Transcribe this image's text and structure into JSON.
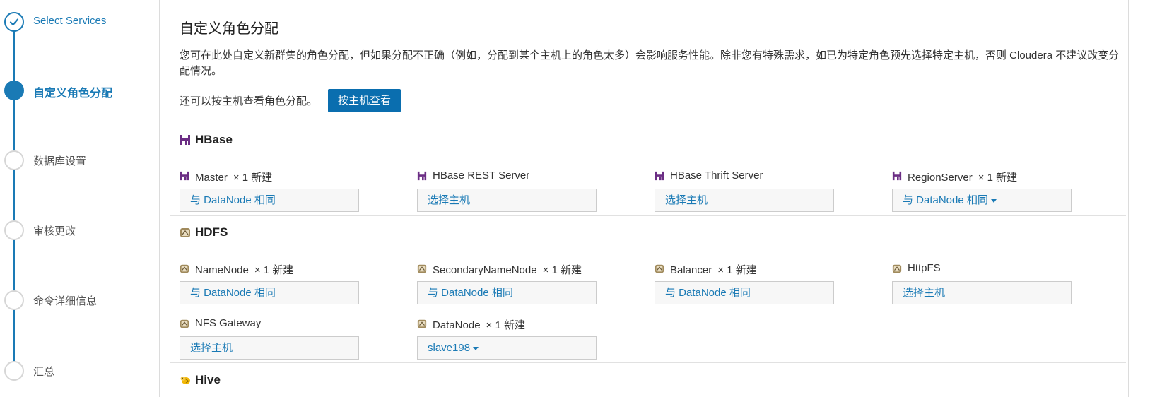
{
  "wizard": {
    "steps": [
      {
        "label": "Select Services",
        "state": "done"
      },
      {
        "label": "自定义角色分配",
        "state": "active"
      },
      {
        "label": "数据库设置",
        "state": "todo"
      },
      {
        "label": "审核更改",
        "state": "todo"
      },
      {
        "label": "命令详细信息",
        "state": "todo"
      },
      {
        "label": "汇总",
        "state": "todo"
      }
    ]
  },
  "page": {
    "title": "自定义角色分配",
    "intro": "您可在此处自定义新群集的角色分配，但如果分配不正确（例如，分配到某个主机上的角色太多）会影响服务性能。除非您有特殊需求，如已为特定角色预先选择特定主机，否则 Cloudera 不建议改变分配情况。",
    "byhost_text": "还可以按主机查看角色分配。",
    "byhost_button": "按主机查看"
  },
  "services": [
    {
      "name": "HBase",
      "icon": "hbase-icon",
      "roles": [
        {
          "name": "Master",
          "count": "× 1 新建",
          "value": "与 DataNode 相同",
          "dropdown": false
        },
        {
          "name": "HBase REST Server",
          "count": "",
          "value": "选择主机",
          "dropdown": false
        },
        {
          "name": "HBase Thrift Server",
          "count": "",
          "value": "选择主机",
          "dropdown": false
        },
        {
          "name": "RegionServer",
          "count": "× 1 新建",
          "value": "与 DataNode 相同",
          "dropdown": true
        }
      ]
    },
    {
      "name": "HDFS",
      "icon": "hdfs-icon",
      "roles": [
        {
          "name": "NameNode",
          "count": "× 1 新建",
          "value": "与 DataNode 相同",
          "dropdown": false
        },
        {
          "name": "SecondaryNameNode",
          "count": "× 1 新建",
          "value": "与 DataNode 相同",
          "dropdown": false
        },
        {
          "name": "Balancer",
          "count": "× 1 新建",
          "value": "与 DataNode 相同",
          "dropdown": false
        },
        {
          "name": "HttpFS",
          "count": "",
          "value": "选择主机",
          "dropdown": false
        },
        {
          "name": "NFS Gateway",
          "count": "",
          "value": "选择主机",
          "dropdown": false
        },
        {
          "name": "DataNode",
          "count": "× 1 新建",
          "value": "slave198",
          "dropdown": true
        }
      ]
    },
    {
      "name": "Hive",
      "icon": "hive-icon",
      "roles": []
    }
  ],
  "colors": {
    "accent": "#1a7ab5",
    "button_bg": "#0a6eaf",
    "hbase_icon": "#6b2d84",
    "hdfs_icon": "#a08a5c",
    "hive_icon": "#f2b705"
  }
}
